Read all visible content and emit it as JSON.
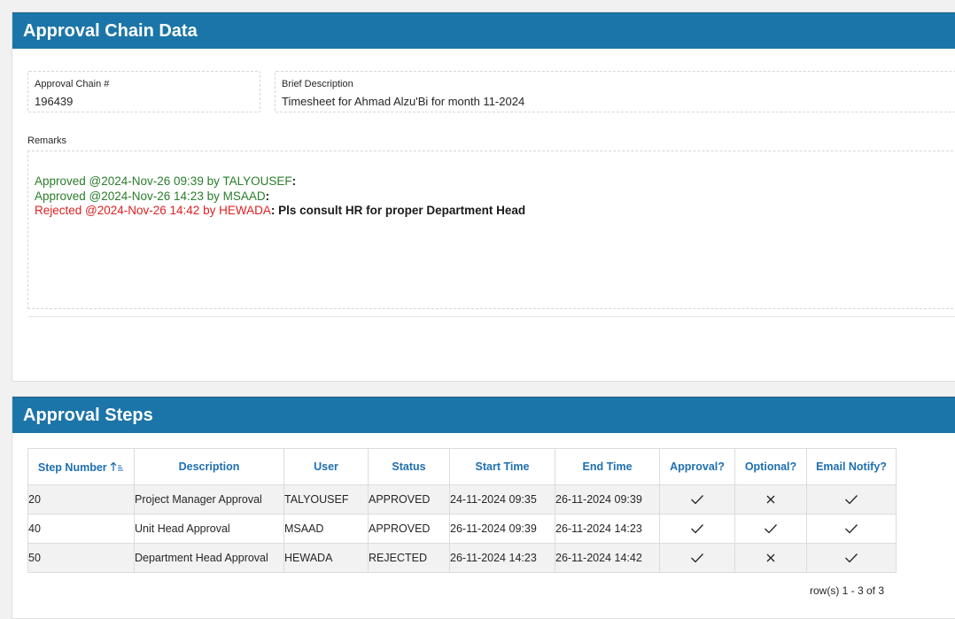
{
  "chain": {
    "header": "Approval Chain Data",
    "chain_no_label": "Approval Chain #",
    "chain_no_value": "196439",
    "brief_label": "Brief Description",
    "brief_value": "Timesheet for Ahmad Alzu'Bi for month 11-2024",
    "remarks_label": "Remarks",
    "remarks": [
      {
        "prefix": "Approved @2024-Nov-26 09:39 by TALYOUSEF",
        "sep": ":",
        "note": "",
        "color": "#2a7d2a"
      },
      {
        "prefix": "Approved @2024-Nov-26 14:23 by MSAAD",
        "sep": ":",
        "note": "",
        "color": "#2a7d2a"
      },
      {
        "prefix": "Rejected @2024-Nov-26 14:42 by HEWADA",
        "sep": ":",
        "note": " Pls consult HR for proper Department Head",
        "color": "#e02020"
      }
    ]
  },
  "steps": {
    "header": "Approval Steps",
    "columns": [
      "Step Number",
      "Description",
      "User",
      "Status",
      "Start Time",
      "End Time",
      "Approval?",
      "Optional?",
      "Email Notify?"
    ],
    "rows": [
      {
        "step": "20",
        "description": "Project Manager Approval",
        "user": "TALYOUSEF",
        "status": "APPROVED",
        "start": "24-11-2024 09:35",
        "end": "26-11-2024 09:39",
        "approval": "check",
        "optional": "cross",
        "email": "check"
      },
      {
        "step": "40",
        "description": "Unit Head Approval",
        "user": "MSAAD",
        "status": "APPROVED",
        "start": "26-11-2024 09:39",
        "end": "26-11-2024 14:23",
        "approval": "check",
        "optional": "check",
        "email": "check"
      },
      {
        "step": "50",
        "description": "Department Head Approval",
        "user": "HEWADA",
        "status": "REJECTED",
        "start": "26-11-2024 14:23",
        "end": "26-11-2024 14:42",
        "approval": "check",
        "optional": "cross",
        "email": "check"
      }
    ],
    "pagination": "row(s) 1 - 3 of 3",
    "sort_icon": "sort-ascending-icon"
  },
  "colors": {
    "header_bg": "#1c75a8",
    "link_blue": "#1e6fb0",
    "approved_green": "#2a7d2a",
    "rejected_red": "#e02020"
  }
}
